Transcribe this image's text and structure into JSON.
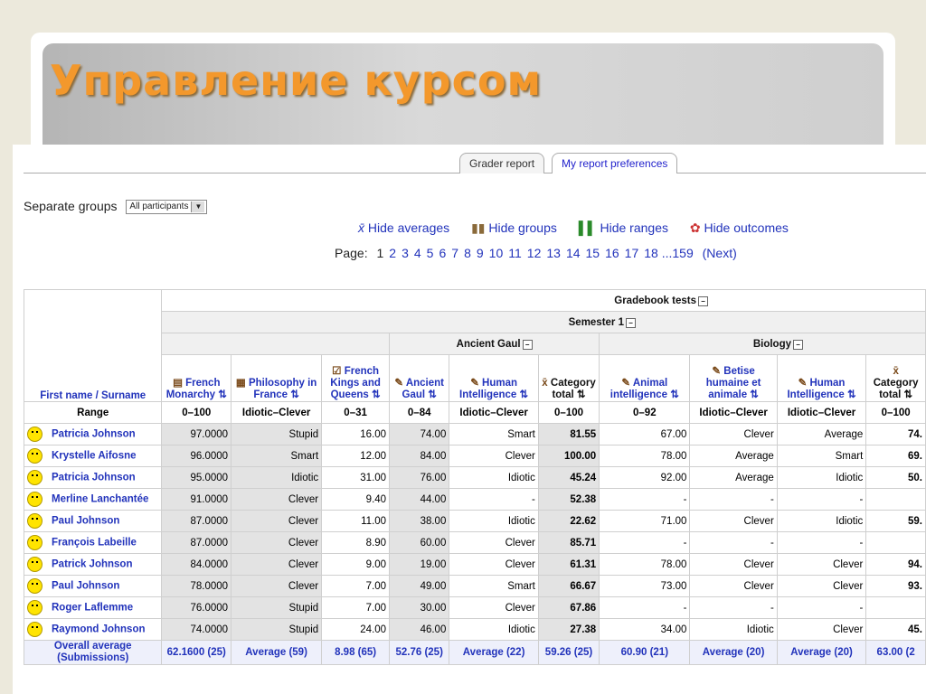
{
  "slide_title": "Управление курсом",
  "tabs": [
    "Grader report",
    "My report preferences"
  ],
  "groups": {
    "label": "Separate groups",
    "value": "All participants"
  },
  "toggles": [
    "Hide averages",
    "Hide groups",
    "Hide ranges",
    "Hide outcomes"
  ],
  "pager": {
    "label": "Page:",
    "pages": [
      "1",
      "2",
      "3",
      "4",
      "5",
      "6",
      "7",
      "8",
      "9",
      "10",
      "11",
      "12",
      "13",
      "14",
      "15",
      "16",
      "17",
      "18 ...159"
    ],
    "next": "(Next)"
  },
  "headers": {
    "category": "Gradebook tests",
    "semester": "Semester 1",
    "ancient": "Ancient Gaul",
    "biology": "Biology",
    "first_col": "First name / Surname",
    "range_label": "Range",
    "items": [
      "French Monarchy",
      "Philosophy in France",
      "French Kings and Queens",
      "Ancient Gaul",
      "Human Intelligence",
      "Category total",
      "Animal intelligence",
      "Betise humaine et animale",
      "Human Intelligence",
      "Category total"
    ]
  },
  "ranges": [
    "0–100",
    "Idiotic–Clever",
    "0–31",
    "0–84",
    "Idiotic–Clever",
    "0–100",
    "0–92",
    "Idiotic–Clever",
    "Idiotic–Clever",
    "0–100"
  ],
  "rows": [
    {
      "name": "Patricia Johnson",
      "c": [
        "97.0000",
        "Stupid",
        "16.00",
        "74.00",
        "Smart",
        "81.55",
        "67.00",
        "Clever",
        "Average",
        "74."
      ]
    },
    {
      "name": "Krystelle Aifosne",
      "c": [
        "96.0000",
        "Smart",
        "12.00",
        "84.00",
        "Clever",
        "100.00",
        "78.00",
        "Average",
        "Smart",
        "69."
      ]
    },
    {
      "name": "Patricia Johnson",
      "c": [
        "95.0000",
        "Idiotic",
        "31.00",
        "76.00",
        "Idiotic",
        "45.24",
        "92.00",
        "Average",
        "Idiotic",
        "50."
      ]
    },
    {
      "name": "Merline Lanchantée",
      "c": [
        "91.0000",
        "Clever",
        "9.40",
        "44.00",
        "-",
        "52.38",
        "-",
        "-",
        "-",
        ""
      ]
    },
    {
      "name": "Paul Johnson",
      "c": [
        "87.0000",
        "Clever",
        "11.00",
        "38.00",
        "Idiotic",
        "22.62",
        "71.00",
        "Clever",
        "Idiotic",
        "59."
      ]
    },
    {
      "name": "François Labeille",
      "c": [
        "87.0000",
        "Clever",
        "8.90",
        "60.00",
        "Clever",
        "85.71",
        "-",
        "-",
        "-",
        ""
      ]
    },
    {
      "name": "Patrick Johnson",
      "c": [
        "84.0000",
        "Clever",
        "9.00",
        "19.00",
        "Clever",
        "61.31",
        "78.00",
        "Clever",
        "Clever",
        "94."
      ]
    },
    {
      "name": "Paul Johnson",
      "c": [
        "78.0000",
        "Clever",
        "7.00",
        "49.00",
        "Smart",
        "66.67",
        "73.00",
        "Clever",
        "Clever",
        "93."
      ]
    },
    {
      "name": "Roger Laflemme",
      "c": [
        "76.0000",
        "Stupid",
        "7.00",
        "30.00",
        "Clever",
        "67.86",
        "-",
        "-",
        "-",
        ""
      ]
    },
    {
      "name": "Raymond Johnson",
      "c": [
        "74.0000",
        "Stupid",
        "24.00",
        "46.00",
        "Idiotic",
        "27.38",
        "34.00",
        "Idiotic",
        "Clever",
        "45."
      ]
    }
  ],
  "average": {
    "label": "Overall average (Submissions)",
    "c": [
      "62.1600 (25)",
      "Average (59)",
      "8.98 (65)",
      "52.76 (25)",
      "Average (22)",
      "59.26 (25)",
      "60.90 (21)",
      "Average (20)",
      "Average (20)",
      "63.00 (2"
    ]
  }
}
